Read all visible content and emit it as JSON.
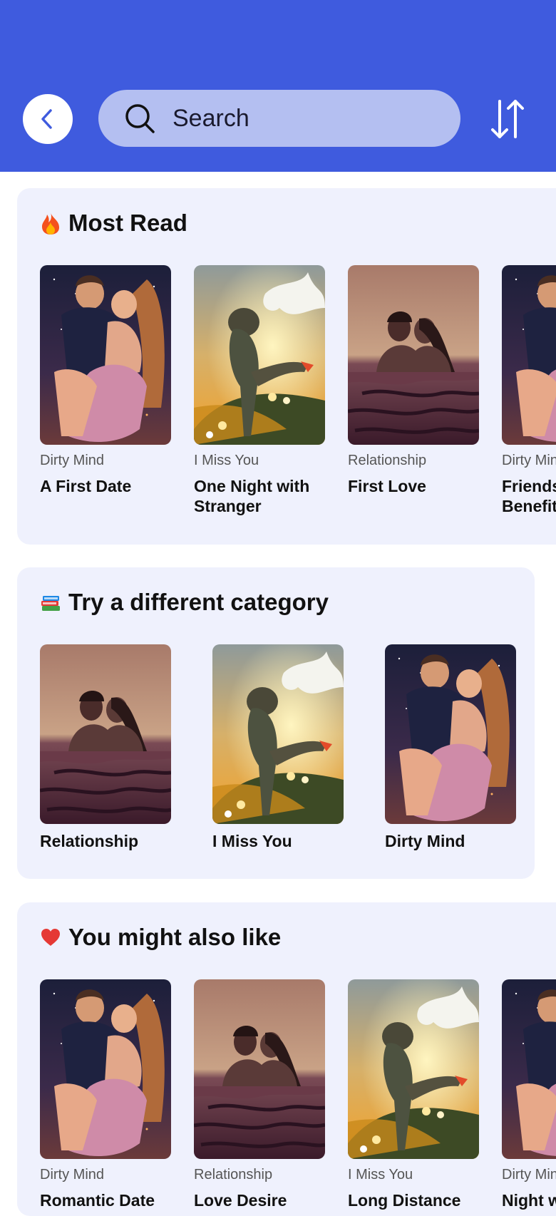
{
  "header": {
    "search_placeholder": "Search",
    "back_icon": "chevron-left-icon",
    "sort_icon": "sort-arrows-icon",
    "accent_color": "#3f5bde"
  },
  "most_read": {
    "title": "Most Read",
    "emoji": "fire-icon",
    "items": [
      {
        "category": "Dirty Mind",
        "title": "A First Date",
        "cover": "kiss"
      },
      {
        "category": "I Miss You",
        "title": "One Night with Stranger",
        "cover": "sunset"
      },
      {
        "category": "Relationship",
        "title": "First Love",
        "cover": "water"
      },
      {
        "category": "Dirty Mind",
        "title": "Friends with Benefits",
        "cover": "kiss"
      }
    ]
  },
  "categories": {
    "title": "Try a different category",
    "emoji": "books-icon",
    "items": [
      {
        "title": "Relationship",
        "cover": "water"
      },
      {
        "title": "I Miss You",
        "cover": "sunset"
      },
      {
        "title": "Dirty Mind",
        "cover": "kiss"
      }
    ]
  },
  "also_like": {
    "title": "You might also like",
    "emoji": "heart-icon",
    "items": [
      {
        "category": "Dirty Mind",
        "title": "Romantic Date",
        "cover": "kiss"
      },
      {
        "category": "Relationship",
        "title": "Love Desire",
        "cover": "water"
      },
      {
        "category": "I Miss You",
        "title": "Long Distance",
        "cover": "sunset"
      },
      {
        "category": "Dirty Mind",
        "title": "Night with",
        "cover": "kiss"
      }
    ]
  }
}
